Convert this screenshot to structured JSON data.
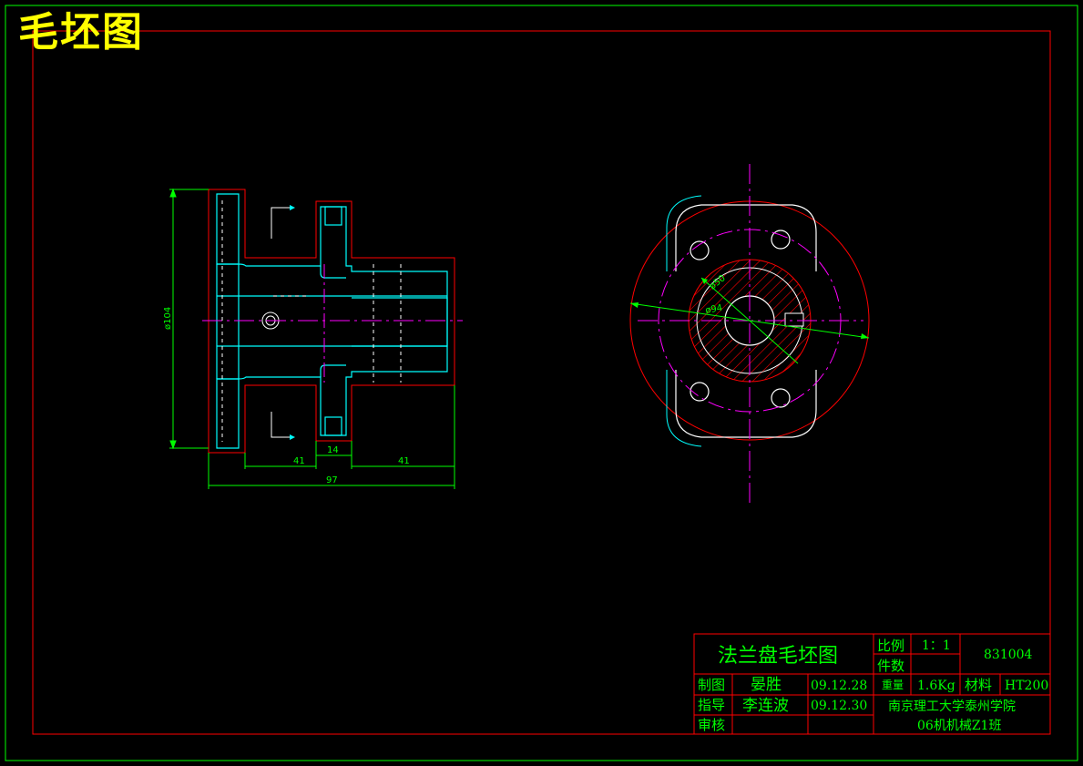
{
  "header": {
    "title": "毛坯图"
  },
  "dimensions": {
    "diameter_left": "ø104",
    "len_left": "41",
    "len_mid": "14",
    "len_right": "41",
    "len_total": "97",
    "dia_inner": "ø50",
    "dia_outer": "ø94"
  },
  "title_block": {
    "drawing_name": "法兰盘毛坯图",
    "scale_label": "比例",
    "scale_value": "1：1",
    "qty_label": "件数",
    "drawing_number": "831004",
    "drawn_label": "制图",
    "drawn_name": "晏胜",
    "drawn_date": "09.12.28",
    "weight_label": "重量",
    "weight_value": "1.6Kg",
    "material_label": "材料",
    "material_value": "HT200",
    "guide_label": "指导",
    "guide_name": "李连波",
    "guide_date": "09.12.30",
    "school": "南京理工大学泰州学院",
    "review_label": "审核",
    "class_name": "06机机械Z1班"
  },
  "colors": {
    "background": "#000000",
    "frame": "#00ff00",
    "outline": "#ff0000",
    "part": "#00ffff",
    "centerline": "#ff00ff",
    "white_lines": "#ffffff",
    "title": "#ffff00"
  }
}
